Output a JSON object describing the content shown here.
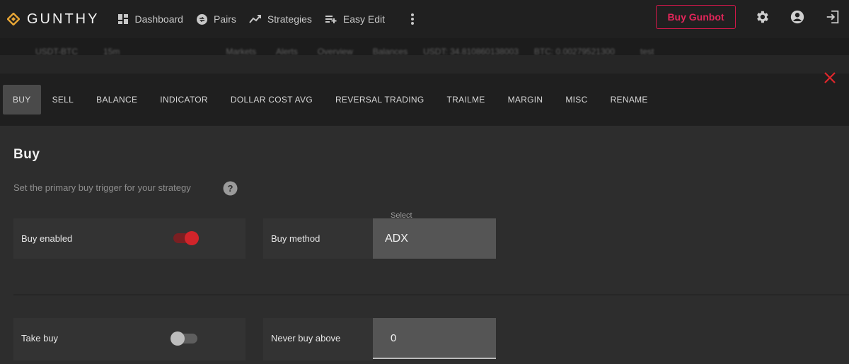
{
  "app": {
    "brand": "GUNTHY",
    "accent": "#e2265a",
    "logo_color": "#e8a636"
  },
  "nav": {
    "items": [
      {
        "label": "Dashboard",
        "icon": "dashboard-icon"
      },
      {
        "label": "Pairs",
        "icon": "pairs-icon"
      },
      {
        "label": "Strategies",
        "icon": "strategies-icon"
      },
      {
        "label": "Easy Edit",
        "icon": "easy-edit-icon"
      }
    ],
    "buy_button": "Buy Gunbot"
  },
  "ticker": {
    "pair": "USDT-BTC",
    "interval": "15m",
    "items": [
      "Markets",
      "Alerts",
      "Overview",
      "Balances"
    ],
    "usdt": "USDT: 34.810860138003",
    "btc": "BTC: 0.00279521300",
    "mode": "test"
  },
  "tabs": [
    "BUY",
    "SELL",
    "BALANCE",
    "INDICATOR",
    "DOLLAR COST AVG",
    "REVERSAL TRADING",
    "TRAILME",
    "MARGIN",
    "MISC",
    "RENAME"
  ],
  "active_tab": "BUY",
  "section": {
    "title": "Buy",
    "subtitle": "Set the primary buy trigger for your strategy"
  },
  "settings": {
    "buy_enabled": {
      "label": "Buy enabled",
      "on": true
    },
    "buy_method": {
      "label": "Buy method",
      "select_label": "Select",
      "value": "ADX"
    },
    "take_buy": {
      "label": "Take buy",
      "on": false
    },
    "never_buy_above": {
      "label": "Never buy above",
      "value": "0"
    }
  }
}
